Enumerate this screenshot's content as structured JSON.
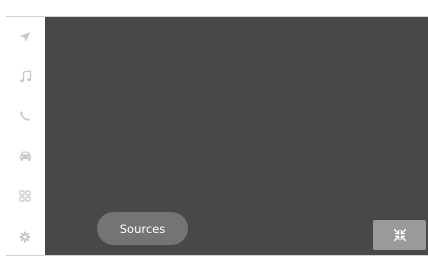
{
  "sidebar": {
    "items": [
      {
        "icon": "navigation-arrow-icon"
      },
      {
        "icon": "music-note-icon"
      },
      {
        "icon": "phone-icon"
      },
      {
        "icon": "car-icon"
      },
      {
        "icon": "apps-grid-icon"
      },
      {
        "icon": "gear-icon"
      }
    ],
    "icon_color": "#c8c8c8"
  },
  "main": {
    "background": "#484848",
    "sources_label": "Sources",
    "minimize_icon": "collapse-arrows-icon"
  }
}
